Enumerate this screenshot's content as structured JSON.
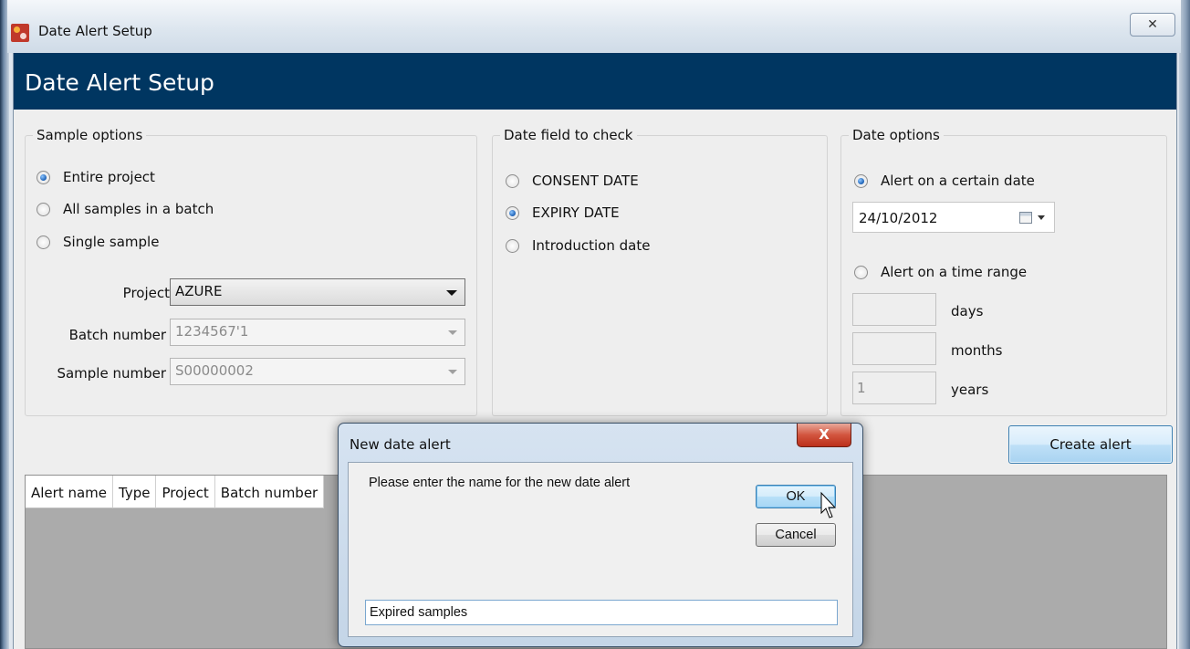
{
  "window": {
    "title": "Date Alert Setup",
    "close_glyph": "✕"
  },
  "banner": {
    "heading": "Date Alert Setup"
  },
  "sample_options": {
    "legend": "Sample options",
    "radios": [
      {
        "label": "Entire project",
        "selected": true
      },
      {
        "label": "All samples in a batch",
        "selected": false
      },
      {
        "label": "Single sample",
        "selected": false
      }
    ],
    "project": {
      "label": "Project",
      "value": "AZURE"
    },
    "batch": {
      "label": "Batch number",
      "value": "1234567'1"
    },
    "sample": {
      "label": "Sample number",
      "value": "S00000002"
    }
  },
  "date_field": {
    "legend": "Date field to check",
    "radios": [
      {
        "label": "CONSENT DATE",
        "selected": false
      },
      {
        "label": "EXPIRY DATE",
        "selected": true
      },
      {
        "label": "Introduction date",
        "selected": false
      }
    ]
  },
  "date_options": {
    "legend": "Date options",
    "certain_date_label": "Alert on a certain date",
    "certain_date_selected": true,
    "date_value": "24/10/2012",
    "time_range_label": "Alert on a time range",
    "time_range_selected": false,
    "days": {
      "value": "",
      "unit": "days"
    },
    "months": {
      "value": "",
      "unit": "months"
    },
    "years": {
      "value": "1",
      "unit": "years"
    }
  },
  "create_alert_label": "Create alert",
  "grid": {
    "columns": [
      "Alert name",
      "Type",
      "Project",
      "Batch number"
    ]
  },
  "dialog": {
    "title": "New date alert",
    "close_glyph": "X",
    "prompt": "Please enter the name for the new date alert",
    "ok_label": "OK",
    "cancel_label": "Cancel",
    "name_value": "Expired samples"
  },
  "colors": {
    "banner": "#003661",
    "accent": "#1a5fb4",
    "close_red": "#c63b24"
  }
}
